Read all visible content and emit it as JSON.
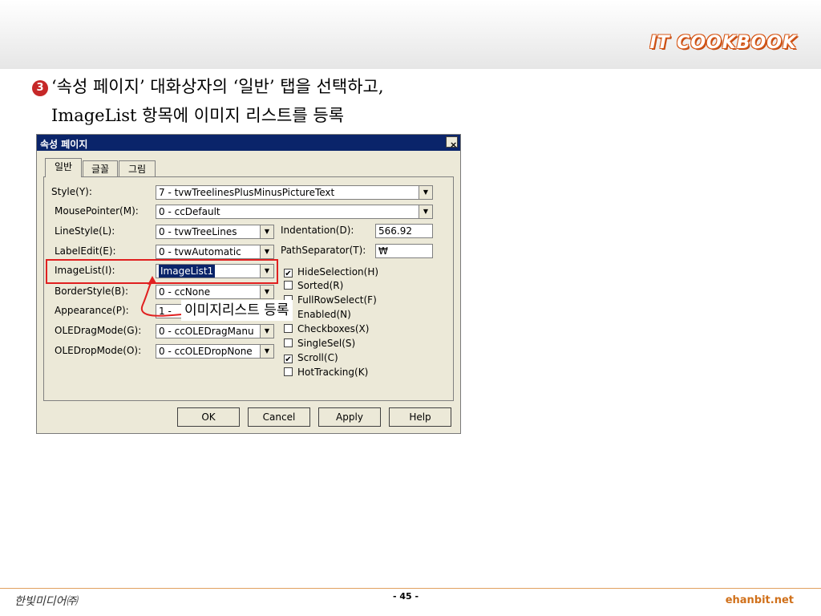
{
  "header": {
    "brand": "IT COOKBOOK"
  },
  "heading": {
    "number": "3",
    "line1": "‘속성 페이지’ 대화상자의 ‘일반’ 탭을 선택하고,",
    "line2": "ImageList 항목에 이미지 리스트를 등록"
  },
  "dialog": {
    "title": "속성 페이지",
    "close_glyph": "×",
    "tabs": [
      {
        "label": "일반",
        "active": true
      },
      {
        "label": "글꼴",
        "active": false
      },
      {
        "label": "그림",
        "active": false
      }
    ],
    "fields": {
      "style": {
        "label": "Style(Y):",
        "value": "7 - tvwTreelinesPlusMinusPictureText"
      },
      "mousepointer": {
        "label": "MousePointer(M):",
        "value": "0 - ccDefault"
      },
      "linestyle": {
        "label": "LineStyle(L):",
        "value": "0 - tvwTreeLines"
      },
      "labeledit": {
        "label": "LabelEdit(E):",
        "value": "0 - tvwAutomatic"
      },
      "imagelist": {
        "label": "ImageList(I):",
        "value": "ImageList1"
      },
      "borderstyle": {
        "label": "BorderStyle(B):",
        "value": "0 - ccNone"
      },
      "appearance": {
        "label": "Appearance(P):",
        "value": "1 -"
      },
      "oledragmode": {
        "label": "OLEDragMode(G):",
        "value": "0 - ccOLEDragManu"
      },
      "oledropmode": {
        "label": "OLEDropMode(O):",
        "value": "0 - ccOLEDropNone"
      },
      "indentation": {
        "label": "Indentation(D):",
        "value": "566.92"
      },
      "pathseparator": {
        "label": "PathSeparator(T):",
        "value": "₩"
      }
    },
    "checkboxes": [
      {
        "label": "HideSelection(H)",
        "checked": true,
        "mark": "✔"
      },
      {
        "label": "Sorted(R)",
        "checked": false,
        "mark": ""
      },
      {
        "label": "FullRowSelect(F)",
        "checked": false,
        "mark": ""
      },
      {
        "label": "Enabled(N)",
        "checked": false,
        "mark": ""
      },
      {
        "label": "Checkboxes(X)",
        "checked": false,
        "mark": ""
      },
      {
        "label": "SingleSel(S)",
        "checked": false,
        "mark": ""
      },
      {
        "label": "Scroll(C)",
        "checked": true,
        "mark": "✔"
      },
      {
        "label": "HotTracking(K)",
        "checked": false,
        "mark": ""
      }
    ],
    "buttons": {
      "ok": "OK",
      "cancel": "Cancel",
      "apply": "Apply",
      "help": "Help"
    },
    "arrow_glyph": "▼"
  },
  "annotation": {
    "callout": "이미지리스트 등록",
    "highlight_color": "#e02020"
  },
  "footer": {
    "publisher": "한빛미디어㈜",
    "page": "- 45 -",
    "site": "ehanbit.net"
  }
}
